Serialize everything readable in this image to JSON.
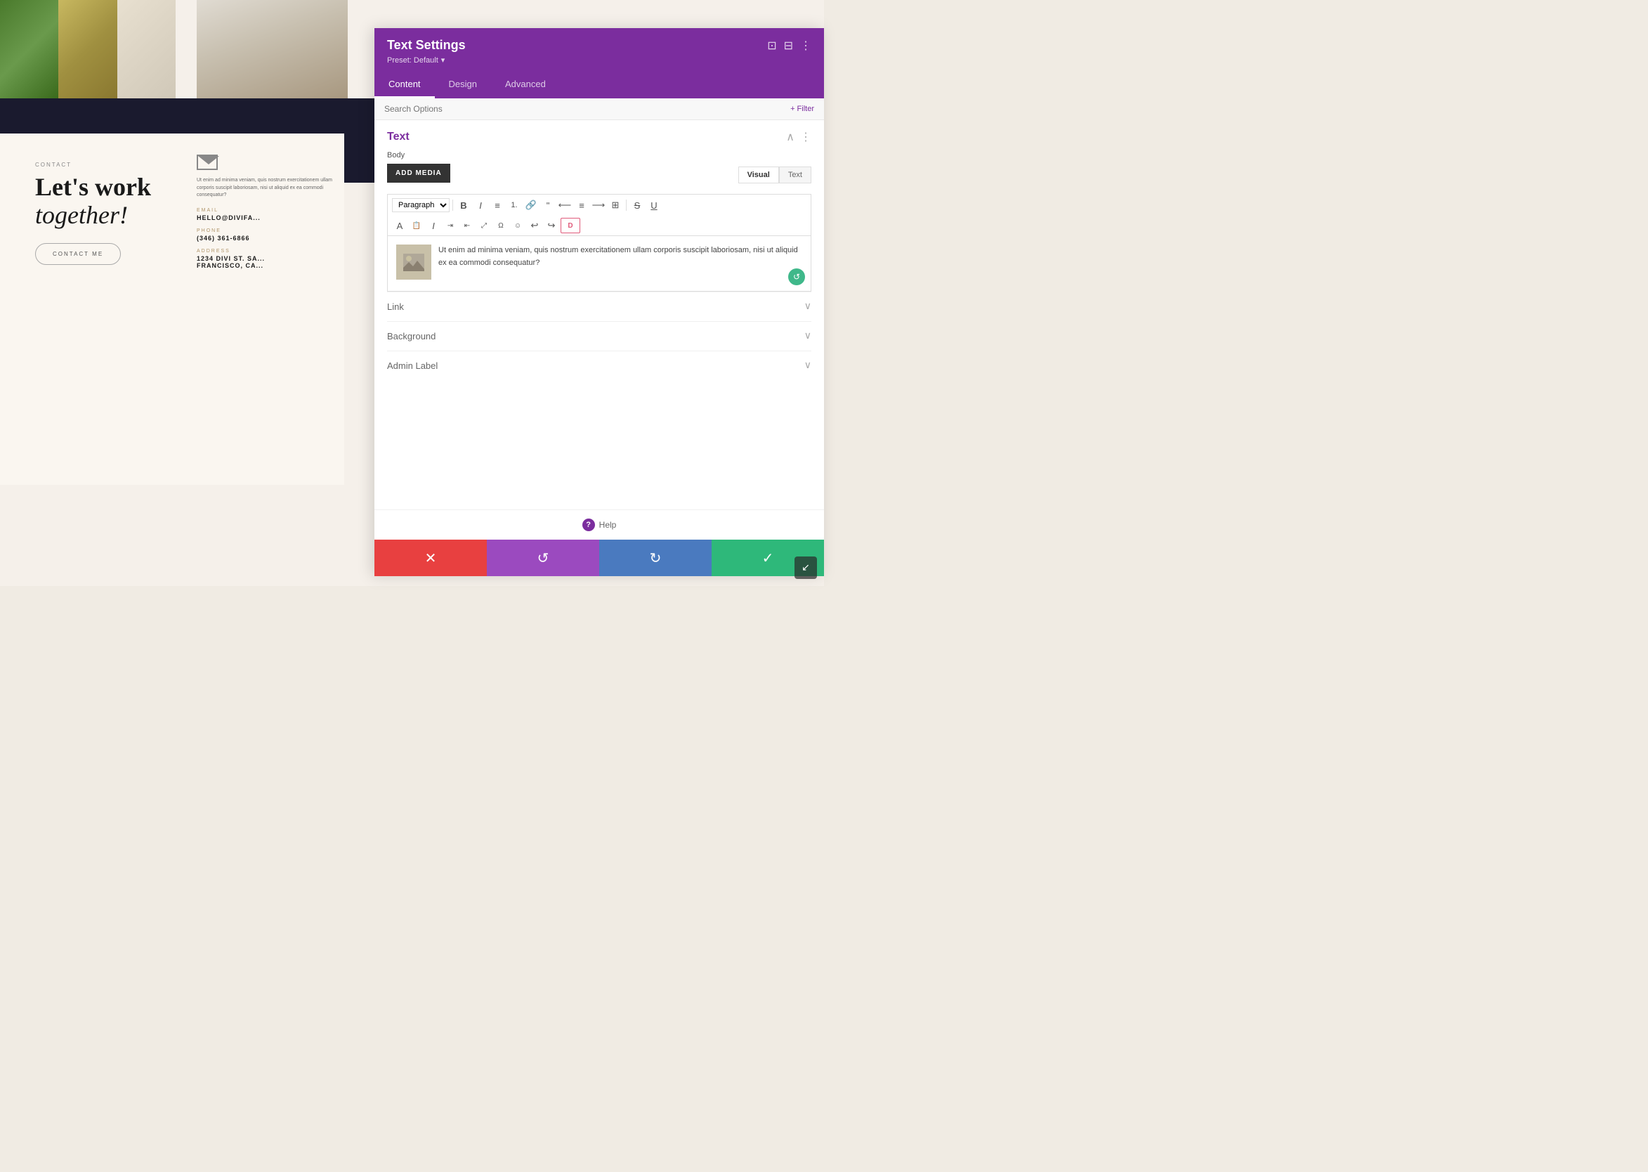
{
  "website": {
    "contact_label": "CONTACT",
    "contact_heading_line1": "Let's work",
    "contact_heading_line2": "together!",
    "contact_btn_label": "CONTACT ME",
    "contact_body_text": "Ut enim ad minima veniam, quis nostrum exercitationem ullam corporis suscipit laboriosam, nisi ut aliquid ex ea commodi consequatur?",
    "email_label": "EMAIL",
    "email_value": "HELLO@DIVIFA...",
    "phone_label": "PHONE",
    "phone_value": "(346) 361-6866",
    "address_label": "ADDRESS",
    "address_value_1": "1234 DIVI ST. SA...",
    "address_value_2": "FRANCISCO, CA..."
  },
  "panel": {
    "title": "Text Settings",
    "preset_label": "Preset: Default",
    "tabs": [
      "Content",
      "Design",
      "Advanced"
    ],
    "active_tab": "Content",
    "search_placeholder": "Search Options",
    "filter_label": "+ Filter",
    "sections": {
      "text": {
        "title": "Text",
        "body_label": "Body",
        "add_media_btn": "ADD MEDIA",
        "visual_btn": "Visual",
        "text_btn": "Text",
        "editor_body": "Ut enim ad minima veniam, quis nostrum exercitationem ullam corporis suscipit laboriosam, nisi ut aliquid ex ea commodi consequatur?",
        "toolbar": {
          "paragraph_select": "Paragraph",
          "buttons": [
            "B",
            "I",
            "≡",
            "—",
            "🔗",
            "\"",
            "≡",
            "≡",
            "≡",
            "⊞",
            "S",
            "U"
          ]
        }
      },
      "link": {
        "title": "Link"
      },
      "background": {
        "title": "Background"
      },
      "admin_label": {
        "title": "Admin Label"
      }
    },
    "footer": {
      "cancel_icon": "✕",
      "undo_icon": "↺",
      "redo_icon": "↻",
      "save_icon": "✓"
    },
    "help_label": "Help"
  },
  "icons": {
    "expand": "⊡",
    "layout": "⊟",
    "more": "⋮",
    "chevron_up": "∧",
    "chevron_down": "∨",
    "collapse": "^"
  }
}
